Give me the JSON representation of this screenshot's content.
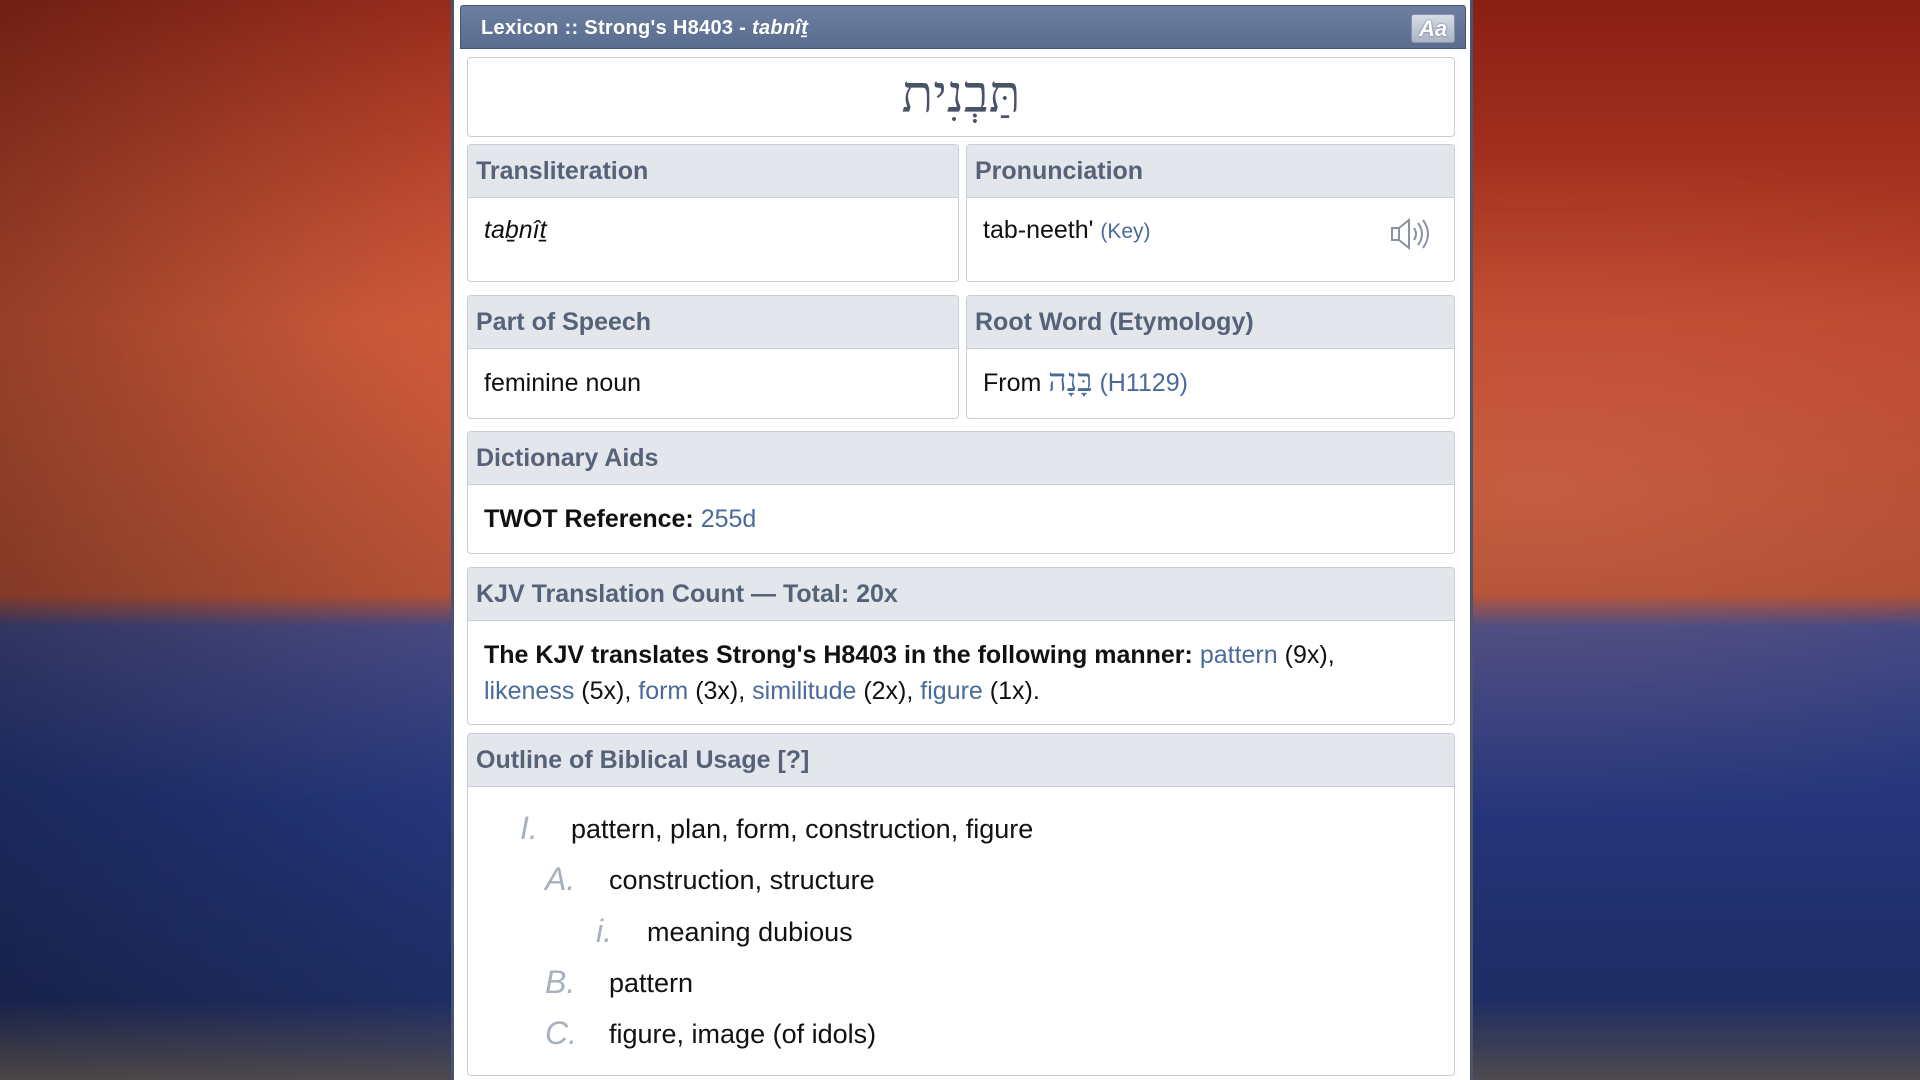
{
  "window": {
    "title_prefix": "Lexicon :: Strong's H8403 - ",
    "title_translit": "tabnîṯ",
    "font_button": "Aa"
  },
  "word": {
    "hebrew": "תַּבְנִית"
  },
  "transliteration": {
    "label": "Transliteration",
    "value": "taḇnîṯ"
  },
  "pronunciation": {
    "label": "Pronunciation",
    "value": "tab-neeth'",
    "key_link": "(Key)",
    "icon": "speaker-icon"
  },
  "part_of_speech": {
    "label": "Part of Speech",
    "value": "feminine noun"
  },
  "root_word": {
    "label": "Root Word (Etymology)",
    "prefix": "From",
    "hebrew": "בָּנָה",
    "ref": "(H1129)"
  },
  "dictionary_aids": {
    "label": "Dictionary Aids",
    "twot_label": "TWOT Reference:",
    "twot_value": "255d"
  },
  "kjv": {
    "label": "KJV Translation Count — Total: 20x",
    "lead": "The KJV translates Strong's H8403 in the following manner:",
    "items": [
      {
        "word": "pattern",
        "count": "(9x)",
        "sep": ","
      },
      {
        "word": "likeness",
        "count": "(5x)",
        "sep": ","
      },
      {
        "word": "form",
        "count": "(3x)",
        "sep": ","
      },
      {
        "word": "similitude",
        "count": "(2x)",
        "sep": ","
      },
      {
        "word": "figure",
        "count": "(1x)",
        "sep": "."
      }
    ]
  },
  "outline": {
    "label": "Outline of Biblical Usage [?]",
    "rows": [
      {
        "marker": "I.",
        "text": "pattern, plan, form, construction, figure"
      },
      {
        "marker": "A.",
        "text": "construction, structure"
      },
      {
        "marker": "i.",
        "text": "meaning dubious"
      },
      {
        "marker": "B.",
        "text": "pattern"
      },
      {
        "marker": "C.",
        "text": "figure, image (of idols)"
      }
    ]
  },
  "colors": {
    "accent": "#4a6b9a",
    "header_bg": "#e3e7ec",
    "titlebar": "#5a6d8e"
  }
}
